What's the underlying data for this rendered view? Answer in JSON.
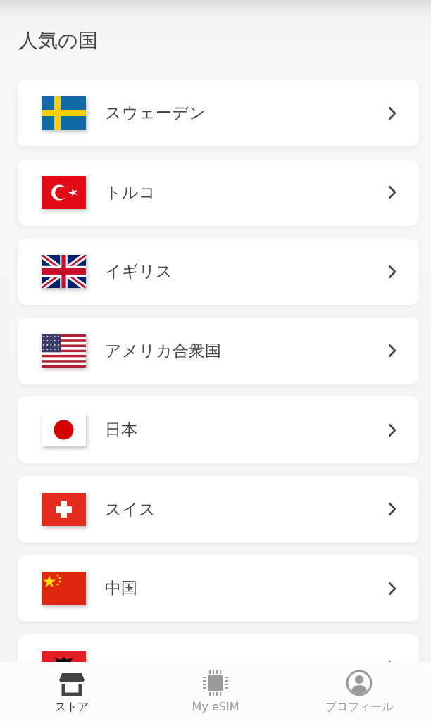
{
  "section_title": "人気の国",
  "countries": [
    {
      "name": "スウェーデン",
      "kind": "se"
    },
    {
      "name": "トルコ",
      "kind": "tr"
    },
    {
      "name": "イギリス",
      "kind": "gb"
    },
    {
      "name": "アメリカ合衆国",
      "kind": "us"
    },
    {
      "name": "日本",
      "kind": "jp"
    },
    {
      "name": "スイス",
      "kind": "ch"
    },
    {
      "name": "中国",
      "kind": "cn"
    },
    {
      "kind": "al"
    }
  ],
  "bottom_nav": [
    {
      "label": "ストア",
      "kind": "store",
      "selected": true
    },
    {
      "label": "My eSIM",
      "kind": "chip",
      "selected": false
    },
    {
      "label": "プロフィール",
      "kind": "profile",
      "selected": false
    }
  ]
}
